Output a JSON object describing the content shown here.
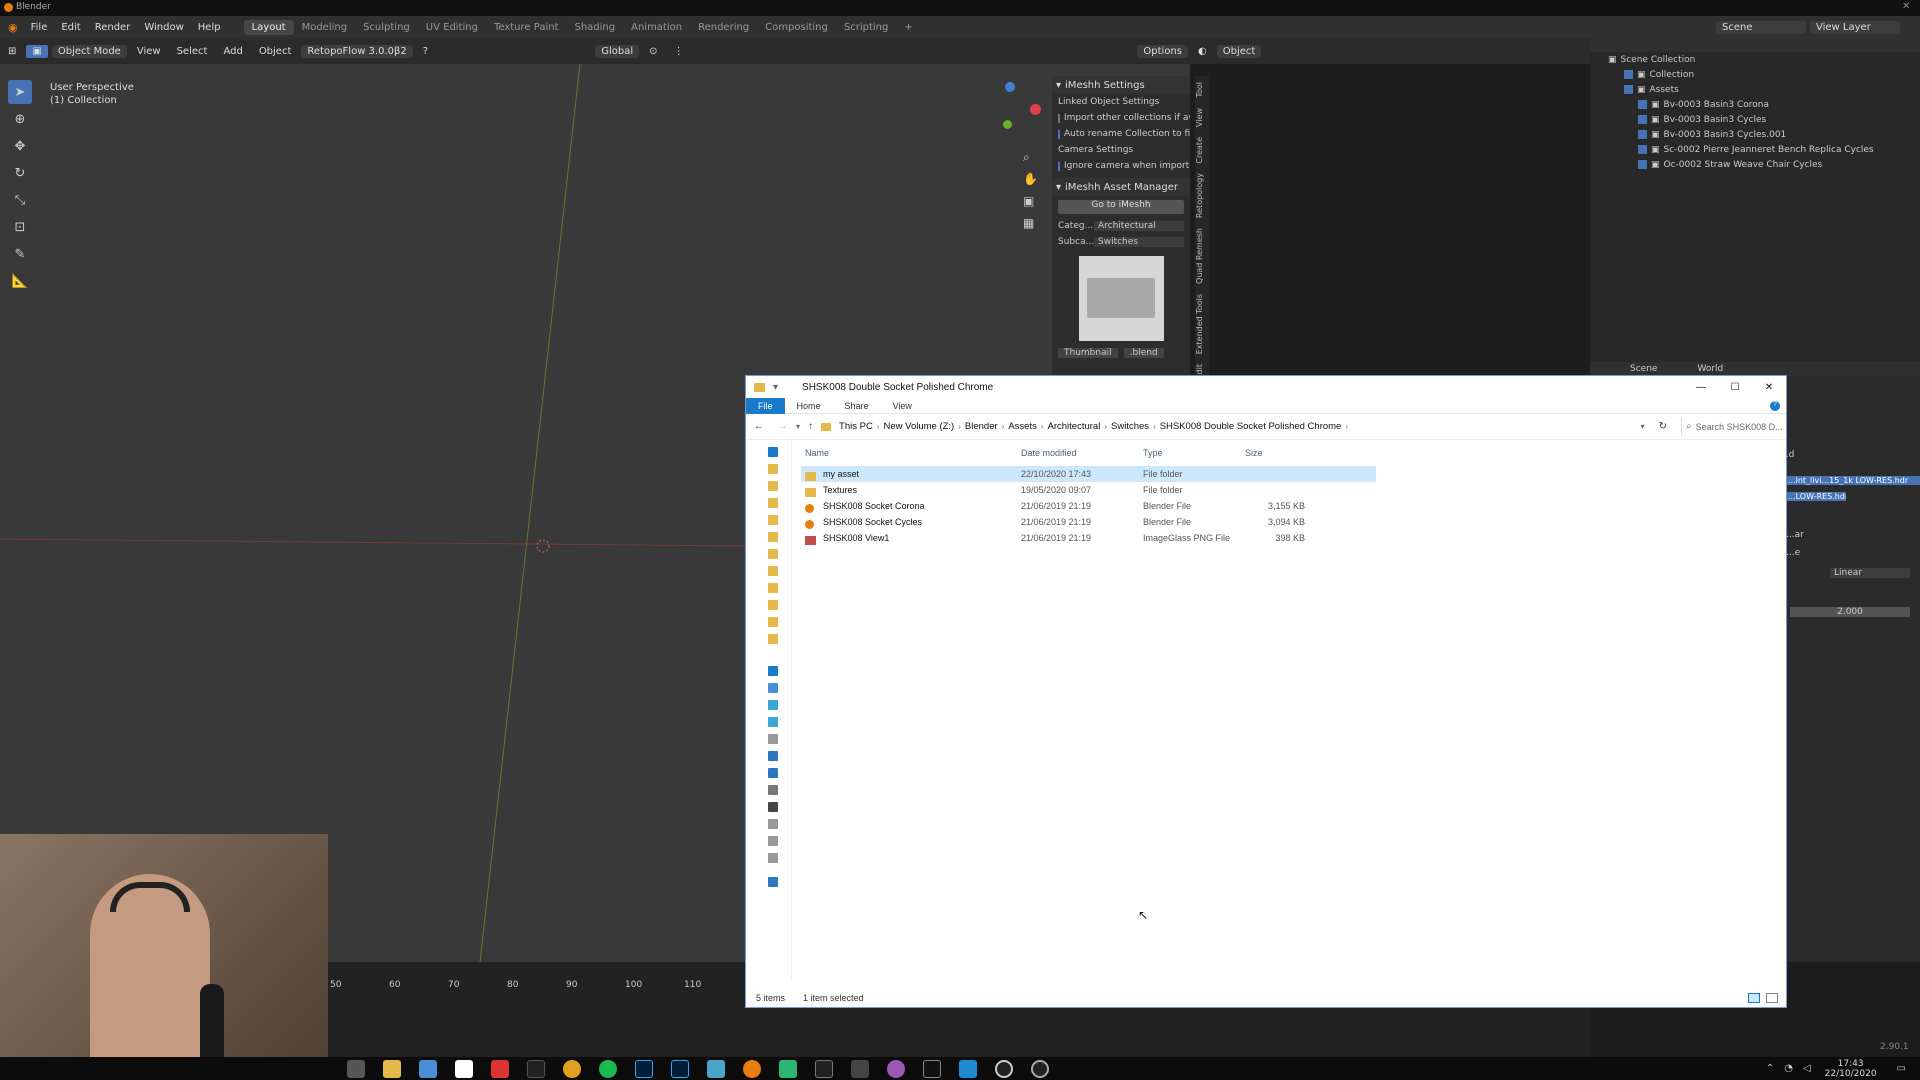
{
  "app": {
    "title": "Blender",
    "version": "2.90.1"
  },
  "menu": [
    "File",
    "Edit",
    "Render",
    "Window",
    "Help"
  ],
  "workspaces": [
    {
      "label": "Layout",
      "active": true
    },
    {
      "label": "Modeling",
      "active": false
    },
    {
      "label": "Sculpting",
      "active": false
    },
    {
      "label": "UV Editing",
      "active": false
    },
    {
      "label": "Texture Paint",
      "active": false
    },
    {
      "label": "Shading",
      "active": false
    },
    {
      "label": "Animation",
      "active": false
    },
    {
      "label": "Rendering",
      "active": false
    },
    {
      "label": "Compositing",
      "active": false
    },
    {
      "label": "Scripting",
      "active": false
    }
  ],
  "top_right": {
    "scene_label": "Scene",
    "view_layer_label": "View Layer"
  },
  "header3d": {
    "mode": "Object Mode",
    "view": "View",
    "select": "Select",
    "add": "Add",
    "object": "Object",
    "addon": "RetopoFlow 3.0.0β2",
    "orientation": "Global",
    "options": "Options",
    "object_dd": "Object"
  },
  "viewport": {
    "perspective": "User Perspective",
    "collection": "(1) Collection"
  },
  "npanel": {
    "section1": "iMeshh Settings",
    "linked": "Linked Object Settings",
    "import_other": "Import other collections if av...",
    "auto_rename": "Auto rename Collection to fil...",
    "camera": "Camera Settings",
    "ignore_camera": "Ignore camera when importing",
    "section2": "iMeshh Asset Manager",
    "go_button": "Go to iMeshh",
    "categ_label": "Categ...",
    "categ_value": "Architectural",
    "subca_label": "Subca...",
    "subca_value": "Switches",
    "thumb_btn": "Thumbnail",
    "blend_btn": ".blend"
  },
  "vtabs": [
    "Tool",
    "View",
    "Create",
    "Retopology",
    "Quad Remesh",
    "Extended Tools",
    "Edit"
  ],
  "outliner": {
    "root": "Scene Collection",
    "items": [
      {
        "label": "Collection",
        "indent": 1
      },
      {
        "label": "Assets",
        "indent": 1
      },
      {
        "label": "Bv-0003 Basin3 Corona",
        "indent": 2
      },
      {
        "label": "Bv-0003 Basin3 Cycles",
        "indent": 2
      },
      {
        "label": "Bv-0003 Basin3 Cycles.001",
        "indent": 2
      },
      {
        "label": "Sc-0002 Pierre Jeanneret Bench Replica Cycles",
        "indent": 2
      },
      {
        "label": "Oc-0002 Straw Weave Chair Cycles",
        "indent": 2
      }
    ]
  },
  "props": {
    "scene_tab": "Scene",
    "world_tab": "World",
    "hdr1": "...int_livi...15_1k LOW-RES.hdr",
    "hdr2": "...LOW-RES.hdr",
    "partial1": "...d",
    "partial2": "...ar",
    "partial3": "...e",
    "interp": "Linear",
    "strength": "2.000"
  },
  "timeline": {
    "ticks": [
      "50",
      "60",
      "70",
      "80",
      "90",
      "100",
      "110"
    ]
  },
  "explorer": {
    "title": "SHSK008 Double Socket Polished Chrome",
    "ribbon": [
      "File",
      "Home",
      "Share",
      "View"
    ],
    "breadcrumb": [
      "This PC",
      "New Volume (Z:)",
      "Blender",
      "Assets",
      "Architectural",
      "Switches",
      "SHSK008 Double Socket Polished Chrome"
    ],
    "search_placeholder": "Search SHSK008 D...",
    "columns": [
      "Name",
      "Date modified",
      "Type",
      "Size"
    ],
    "rows": [
      {
        "name": "my asset",
        "date": "22/10/2020 17:43",
        "type": "File folder",
        "size": "",
        "icon": "folder",
        "selected": true
      },
      {
        "name": "Textures",
        "date": "19/05/2020 09:07",
        "type": "File folder",
        "size": "",
        "icon": "folder",
        "selected": false
      },
      {
        "name": "SHSK008 Socket Corona",
        "date": "21/06/2019 21:19",
        "type": "Blender File",
        "size": "3,155 KB",
        "icon": "blend",
        "selected": false
      },
      {
        "name": "SHSK008 Socket Cycles",
        "date": "21/06/2019 21:19",
        "type": "Blender File",
        "size": "3,094 KB",
        "icon": "blend",
        "selected": false
      },
      {
        "name": "SHSK008 View1",
        "date": "21/06/2019 21:19",
        "type": "ImageGlass PNG File",
        "size": "398 KB",
        "icon": "png",
        "selected": false
      }
    ],
    "status_items": "5 items",
    "status_selected": "1 item selected"
  },
  "taskbar": {
    "time": "17:43",
    "date": "22/10/2020"
  },
  "colors": {
    "accent": "#4772b3",
    "explorer_blue": "#1979ca",
    "selection": "#cce8ff"
  }
}
